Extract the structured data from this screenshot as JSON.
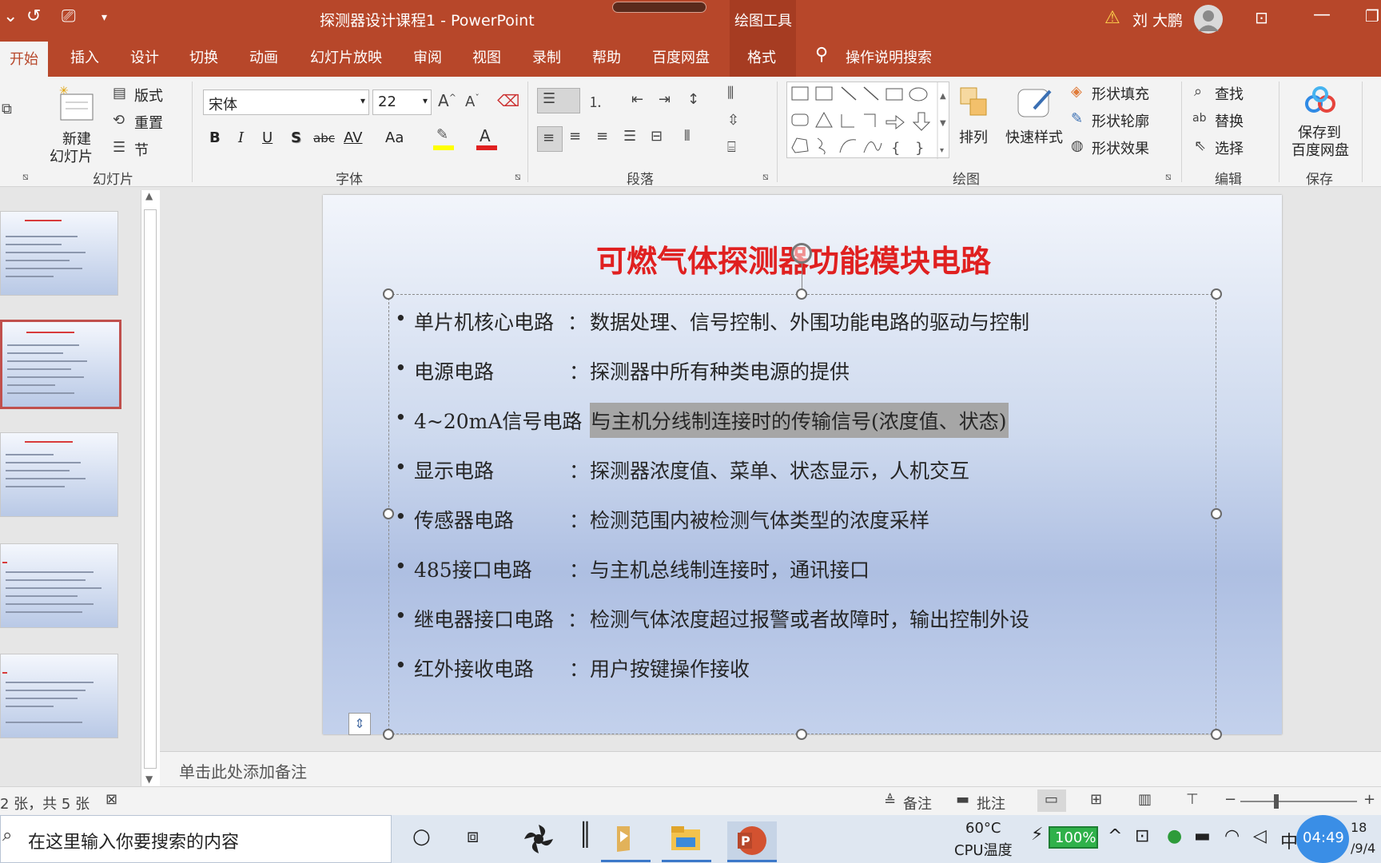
{
  "title_bar": {
    "document_title": "探测器设计课程1  -  PowerPoint",
    "contextual_tab_group": "绘图工具",
    "user_name": "刘 大鹏",
    "warning_icon": "warning-icon",
    "undo_icon": "undo-icon",
    "presenter_icon": "presenter-icon",
    "accent_color": "#b7472a"
  },
  "tabs": [
    "开始",
    "插入",
    "设计",
    "切换",
    "动画",
    "幻灯片放映",
    "审阅",
    "视图",
    "录制",
    "帮助",
    "百度网盘",
    "格式"
  ],
  "active_tab": "开始",
  "tell_me": "操作说明搜索",
  "ribbon": {
    "slides_group": {
      "label": "幻灯片",
      "new_slide_line1": "新建",
      "new_slide_line2": "幻灯片",
      "layout": "版式",
      "reset": "重置",
      "section": "节"
    },
    "font_group": {
      "label": "字体",
      "font_name": "宋体",
      "font_size": "22",
      "bold": "B",
      "italic": "I",
      "underline": "U",
      "shadow": "S",
      "strike": "abc",
      "spacing": "AV",
      "case": "Aa",
      "font_color_glyph": "A"
    },
    "paragraph_group": {
      "label": "段落"
    },
    "drawing_group": {
      "label": "绘图",
      "arrange": "排列",
      "quick_styles": "快速样式",
      "shape_fill": "形状填充",
      "shape_outline": "形状轮廓",
      "shape_effects": "形状效果"
    },
    "editing_group": {
      "label": "编辑",
      "find": "查找",
      "replace": "替换",
      "select": "选择"
    },
    "save_group": {
      "label": "保存",
      "save_line1": "保存到",
      "save_line2": "百度网盘"
    }
  },
  "slide": {
    "title": "可燃气体探测器功能模块电路",
    "bullets": [
      {
        "label": "单片机核心电路",
        "colon": "：",
        "desc": "数据处理、信号控制、外围功能电路的驱动与控制"
      },
      {
        "label": "电源电路",
        "colon": "：",
        "desc": "探测器中所有种类电源的提供"
      },
      {
        "label": "4~20mA信号电路",
        "colon": "：",
        "desc": "与主机分线制连接时的传输信号(浓度值、状态)"
      },
      {
        "label": "显示电路",
        "colon": "：",
        "desc": "探测器浓度值、菜单、状态显示，人机交互"
      },
      {
        "label": "传感器电路",
        "colon": "：",
        "desc": "检测范围内被检测气体类型的浓度采样"
      },
      {
        "label": "485接口电路",
        "colon": "：",
        "desc": "与主机总线制连接时，通讯接口"
      },
      {
        "label": "继电器接口电路",
        "colon": "：",
        "desc": "检测气体浓度超过报警或者故障时，输出控制外设"
      },
      {
        "label": "红外接收电路",
        "colon": "：",
        "desc": "用户按键操作接收"
      }
    ],
    "title_color": "#e02020"
  },
  "notes_placeholder": "单击此处添加备注",
  "status_bar": {
    "slide_info": "2 张，共 5 张",
    "notes": "备注",
    "comments": "批注",
    "zoom_minus": "−",
    "zoom_plus": "+"
  },
  "taskbar": {
    "search_placeholder": "在这里输入你要搜索的内容",
    "temp": "60°C",
    "cpu_label": "CPU温度",
    "battery": "100%",
    "ime": "中",
    "clock_bubble": "04:49",
    "clock_right_top": "18",
    "clock_right_bottom": "/9/4"
  }
}
